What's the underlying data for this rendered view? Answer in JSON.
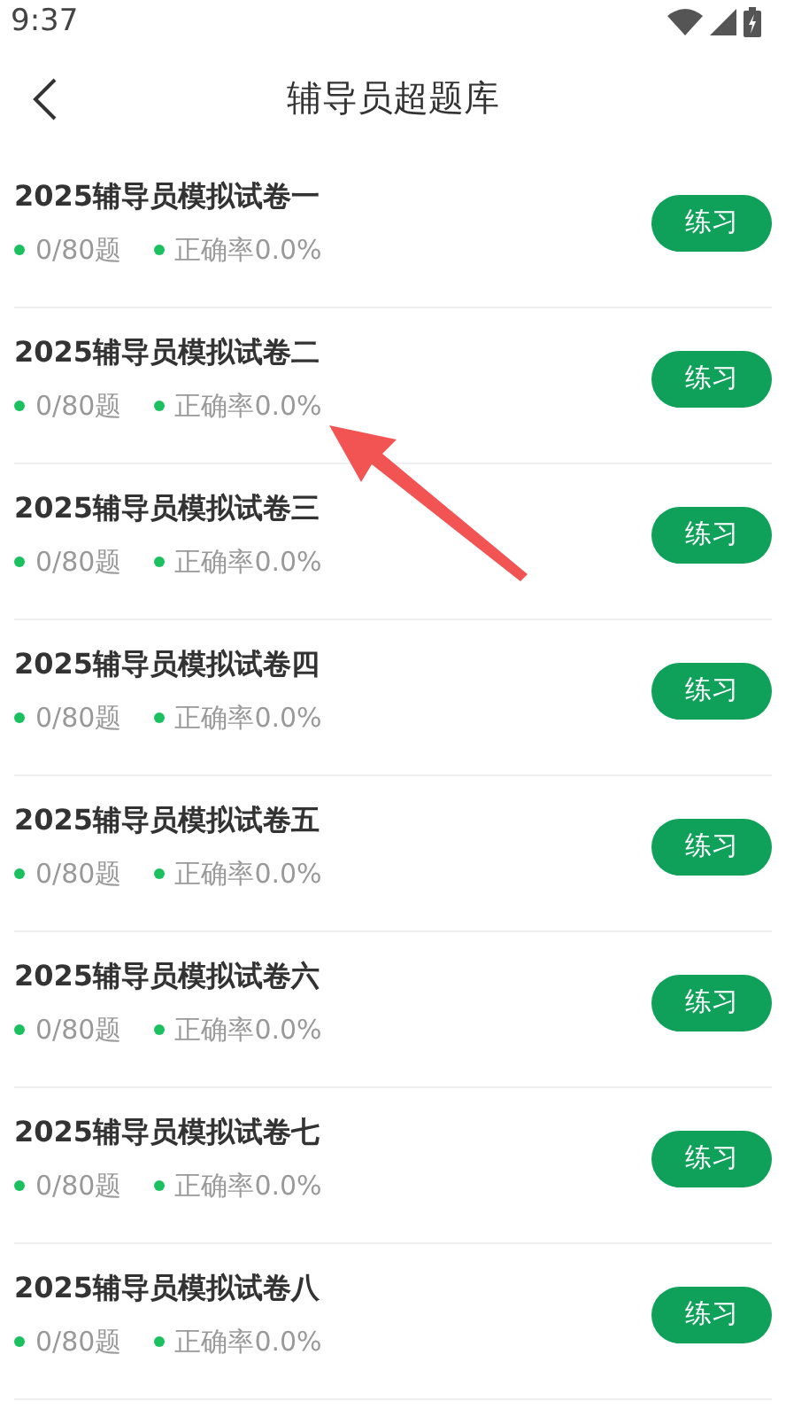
{
  "status_bar": {
    "time": "9:37"
  },
  "header": {
    "title": "辅导员超题库"
  },
  "papers": [
    {
      "title": "2025辅导员模拟试卷一",
      "progress": "0/80题",
      "accuracy": "正确率0.0%",
      "button": "练习"
    },
    {
      "title": "2025辅导员模拟试卷二",
      "progress": "0/80题",
      "accuracy": "正确率0.0%",
      "button": "练习"
    },
    {
      "title": "2025辅导员模拟试卷三",
      "progress": "0/80题",
      "accuracy": "正确率0.0%",
      "button": "练习"
    },
    {
      "title": "2025辅导员模拟试卷四",
      "progress": "0/80题",
      "accuracy": "正确率0.0%",
      "button": "练习"
    },
    {
      "title": "2025辅导员模拟试卷五",
      "progress": "0/80题",
      "accuracy": "正确率0.0%",
      "button": "练习"
    },
    {
      "title": "2025辅导员模拟试卷六",
      "progress": "0/80题",
      "accuracy": "正确率0.0%",
      "button": "练习"
    },
    {
      "title": "2025辅导员模拟试卷七",
      "progress": "0/80题",
      "accuracy": "正确率0.0%",
      "button": "练习"
    },
    {
      "title": "2025辅导员模拟试卷八",
      "progress": "0/80题",
      "accuracy": "正确率0.0%",
      "button": "练习"
    }
  ]
}
